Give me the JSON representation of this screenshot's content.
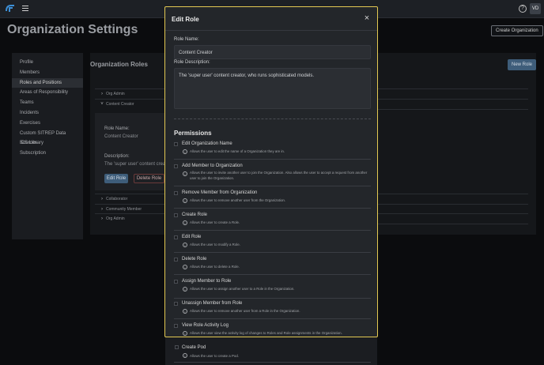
{
  "topbar": {
    "avatar_initials": "VD",
    "help": "?"
  },
  "page": {
    "title": "Organization Settings",
    "create_org_button": "Create Organization"
  },
  "sidebar": {
    "items": [
      {
        "label": "Profile"
      },
      {
        "label": "Members"
      },
      {
        "label": "Roles and Positions"
      },
      {
        "label": "Areas of Responsibility"
      },
      {
        "label": "Teams"
      },
      {
        "label": "Incidents"
      },
      {
        "label": "Exercises"
      },
      {
        "label": "Custom SITREP Data Sources"
      },
      {
        "label": "ICS Library"
      },
      {
        "label": "Subscription"
      }
    ],
    "active_index": 2
  },
  "roles": {
    "title": "Organization Roles",
    "new_role_button": "New Role",
    "rows": [
      {
        "label": "Org Admin"
      },
      {
        "label": "Content Creator"
      },
      {
        "label": "Collaborator"
      },
      {
        "label": "Community Member"
      },
      {
        "label": "Org Admin"
      }
    ],
    "detail": {
      "role_name_label": "Role Name:",
      "role_name": "Content Creator",
      "description_label": "Description:",
      "description": "The 'super user' content creato",
      "edit_button": "Edit Role",
      "delete_button": "Delete Role"
    }
  },
  "modal": {
    "title": "Edit Role",
    "close": "×",
    "role_name_label": "Role Name:",
    "role_name_value": "Content Creator",
    "role_description_label": "Role Description:",
    "role_description_value": "The 'super user' content creator, who runs sophisticated models.",
    "permissions_title": "Permissions",
    "permissions": [
      {
        "name": "Edit Organization Name",
        "description": "Allows the user to edit the name of a Organization they are in."
      },
      {
        "name": "Add Member to Organization",
        "description": "Allows the user to invite another user to join the Organization. Also allows the user to accept a request from another user to join the Organization."
      },
      {
        "name": "Remove Member from Organization",
        "description": "Allows the user to remove another user from the Organization."
      },
      {
        "name": "Create Role",
        "description": "Allows the user to create a Role."
      },
      {
        "name": "Edit Role",
        "description": "Allows the user to modify a Role."
      },
      {
        "name": "Delete Role",
        "description": "Allows the user to delete a Role."
      },
      {
        "name": "Assign Member to Role",
        "description": "Allows the user to assign another user to a Role in the Organization."
      },
      {
        "name": "Unassign Member from Role",
        "description": "Allows the user to remove another user from a Role in the Organization."
      },
      {
        "name": "View Role Activity Log",
        "description": "Allows the user view the activity log of changes to Roles and Role assignments in the Organization."
      }
    ]
  },
  "below_modal": {
    "name": "Create Pod",
    "description": "Allows the user to create a Pod."
  }
}
